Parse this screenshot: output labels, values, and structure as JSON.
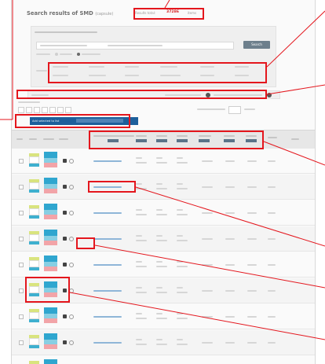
{
  "page": {
    "title": "Search results of SMD",
    "title_suffix": "(capsule)",
    "count_label": "Results total:",
    "count_value": "37286",
    "count_unit": "items",
    "search_button": "Search",
    "selection_label": "Add selected to list"
  },
  "colors": {
    "highlight": "#e4161d",
    "selection_bar": "#1d5f9b",
    "header_badge": "#5a7389",
    "search_button": "#6d7f8c",
    "count": "#d62021"
  },
  "icons": [
    "check-icon",
    "thumbnail-icon",
    "package-icon",
    "cart-icon",
    "info-icon"
  ],
  "rows": [
    {
      "index": 1,
      "has_cart": true
    },
    {
      "index": 2,
      "has_cart": true
    },
    {
      "index": 3,
      "has_cart": true
    },
    {
      "index": 4,
      "has_cart": true
    },
    {
      "index": 5,
      "has_cart": true
    },
    {
      "index": 6,
      "has_cart": true
    },
    {
      "index": 7,
      "has_cart": true
    },
    {
      "index": 8,
      "has_cart": true
    },
    {
      "index": 9,
      "has_cart": true
    }
  ]
}
